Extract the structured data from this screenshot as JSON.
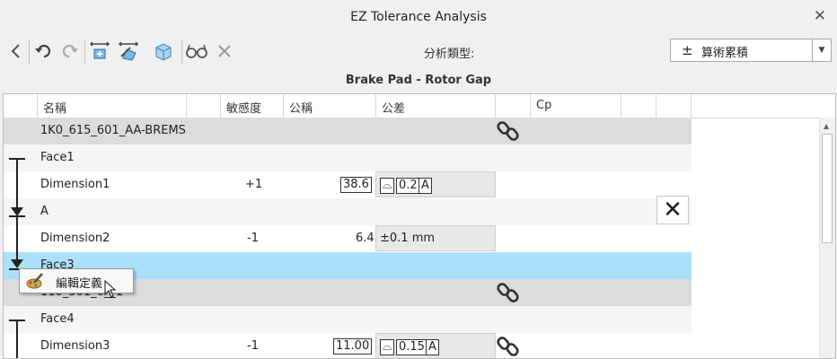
{
  "window": {
    "title": "EZ Tolerance Analysis",
    "close_icon": "close-icon"
  },
  "toolbar": {
    "icons": [
      "back-icon",
      "undo-icon",
      "redo-icon",
      "add-dimension-icon",
      "edit-dimension-icon",
      "cube-icon",
      "glasses-icon",
      "delete-icon"
    ],
    "analysis_type_label": "分析類型:",
    "analysis_type_symbol": "±",
    "analysis_type_value": "算術累積"
  },
  "stack_title": "Brake Pad - Rotor Gap",
  "columns": {
    "name": "名稱",
    "sensitivity": "敏感度",
    "nominal": "公稱",
    "tolerance": "公差",
    "cp": "Cp"
  },
  "rows": [
    {
      "name": "1K0_615_601_AA-BREMS",
      "sensitivity": "",
      "nominal": "",
      "tolerance": ""
    },
    {
      "name": "Face1",
      "sensitivity": "",
      "nominal": "",
      "tolerance": ""
    },
    {
      "name": "Dimension1",
      "sensitivity": "+1",
      "nominal": "38.6",
      "tol_symbol": "⌓",
      "tolerance": "0.2",
      "datum": "A"
    },
    {
      "name": "A",
      "sensitivity": "",
      "nominal": "",
      "tolerance": ""
    },
    {
      "name": "Dimension2",
      "sensitivity": "-1",
      "nominal": "6.4",
      "tolerance": "±0.1 mm"
    },
    {
      "name": "Face3",
      "sensitivity": "",
      "nominal": "",
      "tolerance": ""
    },
    {
      "name": "110_501_6__1",
      "sensitivity": "",
      "nominal": "",
      "tolerance": ""
    },
    {
      "name": "Face4",
      "sensitivity": "",
      "nominal": "",
      "tolerance": ""
    },
    {
      "name": "Dimension3",
      "sensitivity": "-1",
      "nominal": "11.00",
      "tol_symbol": "⌓",
      "tolerance": "0.15",
      "datum": "A"
    }
  ],
  "context_menu": {
    "edit_definition": "編輯定義"
  },
  "colors": {
    "selected_row": "#abe0fa",
    "part_row": "#dcdcdc"
  }
}
